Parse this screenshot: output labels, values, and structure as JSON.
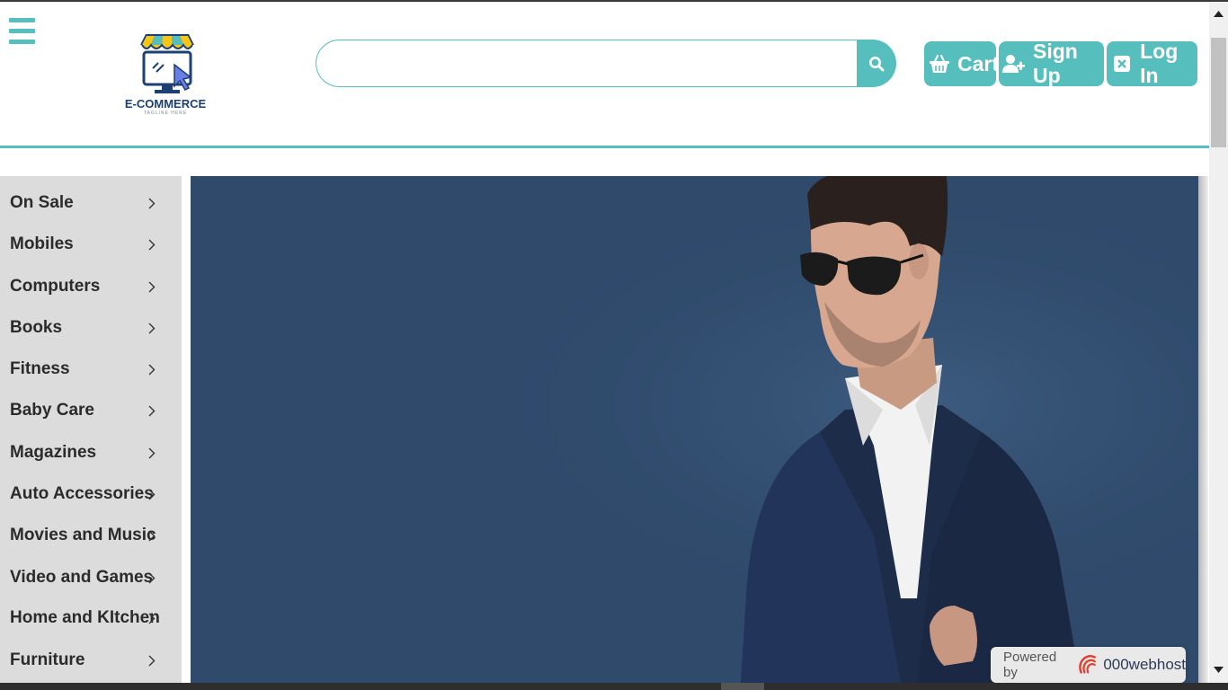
{
  "header": {
    "menu_icon": "hamburger-icon",
    "logo": {
      "title": "E-COMMERCE",
      "tagline": "TAGLINE HERE"
    },
    "search": {
      "placeholder": "",
      "value": "",
      "icon": "search-icon"
    },
    "buttons": {
      "cart": {
        "label": "Cart",
        "icon": "basket-icon"
      },
      "signup": {
        "label": "Sign Up",
        "icon": "user-plus-icon"
      },
      "login": {
        "label": "Log In",
        "icon": "close-box-icon"
      }
    }
  },
  "sidebar": {
    "categories": [
      {
        "label": "On Sale"
      },
      {
        "label": "Mobiles"
      },
      {
        "label": "Computers"
      },
      {
        "label": "Books"
      },
      {
        "label": "Fitness"
      },
      {
        "label": "Baby Care"
      },
      {
        "label": "Magazines"
      },
      {
        "label": "Auto Accessories"
      },
      {
        "label": "Movies and Music"
      },
      {
        "label": "Video and Games"
      },
      {
        "label": "Home and KItchen"
      },
      {
        "label": "Furniture"
      }
    ]
  },
  "badge": {
    "powered": "Powered by",
    "host": "000webhost"
  },
  "colors": {
    "accent": "#56bfbd",
    "hero_bg": "#2f4a6b",
    "sidebar_bg": "#dcdcdc",
    "brand_navy": "#1c3f74"
  }
}
